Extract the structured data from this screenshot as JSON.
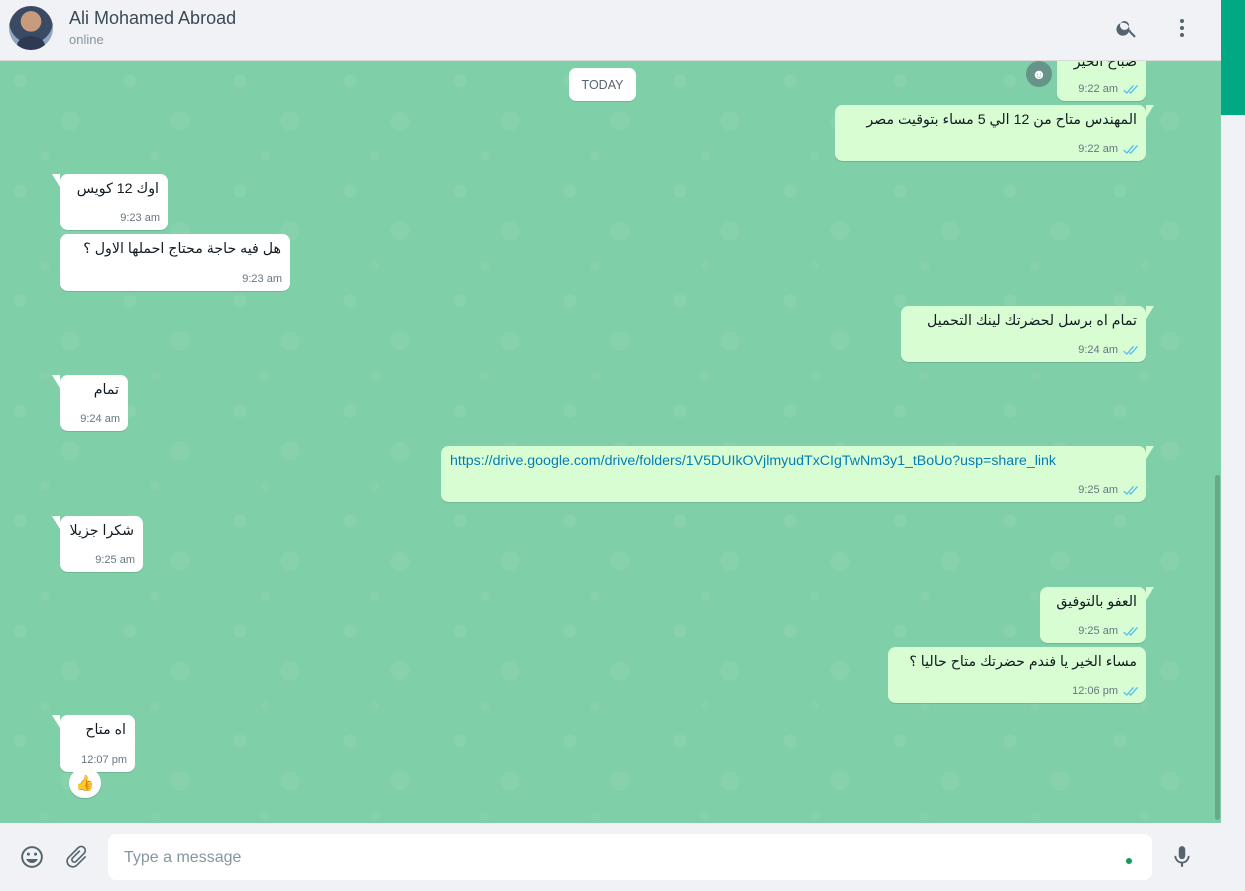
{
  "header": {
    "contact_name": "Ali Mohamed Abroad",
    "contact_status": "online",
    "search_icon": "search-icon",
    "menu_icon": "kebab-menu-icon"
  },
  "chat": {
    "day_separator": "TODAY",
    "messages": [
      {
        "direction": "out",
        "text": "صباح الخير",
        "time": "9:22 am",
        "status": "read"
      },
      {
        "direction": "out",
        "text": "المهندس متاح من 12 الي 5 مساء بتوقيت مصر",
        "time": "9:22 am",
        "status": "read"
      },
      {
        "direction": "in",
        "text": "اوك 12 كويس",
        "time": "9:23 am"
      },
      {
        "direction": "in",
        "text": "هل فيه حاجة محتاج احملها الاول ؟",
        "time": "9:23 am"
      },
      {
        "direction": "out",
        "text": "تمام  اه برسل لحضرتك لينك التحميل",
        "time": "9:24 am",
        "status": "read"
      },
      {
        "direction": "in",
        "text": "تمام",
        "time": "9:24 am"
      },
      {
        "direction": "out",
        "text": "https://drive.google.com/drive/folders/1V5DUIkOVjlmyudTxCIgTwNm3y1_tBoUo?usp=share_link",
        "time": "9:25 am",
        "status": "read",
        "is_link": true
      },
      {
        "direction": "in",
        "text": "شكرا جزيلا",
        "time": "9:25 am"
      },
      {
        "direction": "out",
        "text": "العفو بالتوفيق",
        "time": "9:25 am",
        "status": "read"
      },
      {
        "direction": "out",
        "text": "مساء الخير يا فندم حضرتك متاح حاليا ؟",
        "time": "12:06 pm",
        "status": "read"
      },
      {
        "direction": "in",
        "text": "اه متاح",
        "time": "12:07 pm",
        "reaction": "👍"
      }
    ],
    "reaction_button_icon": "emoji-reaction-icon"
  },
  "composer": {
    "placeholder": "Type a message",
    "value": "",
    "emoji_icon": "emoji-icon",
    "attach_icon": "paperclip-icon",
    "mic_icon": "microphone-icon"
  },
  "colors": {
    "chat_background": "#7fcfa8",
    "outgoing_bubble": "#d9fdd3",
    "incoming_bubble": "#ffffff",
    "accent": "#00a884",
    "read_ticks": "#53bdeb",
    "link": "#027eb5"
  }
}
